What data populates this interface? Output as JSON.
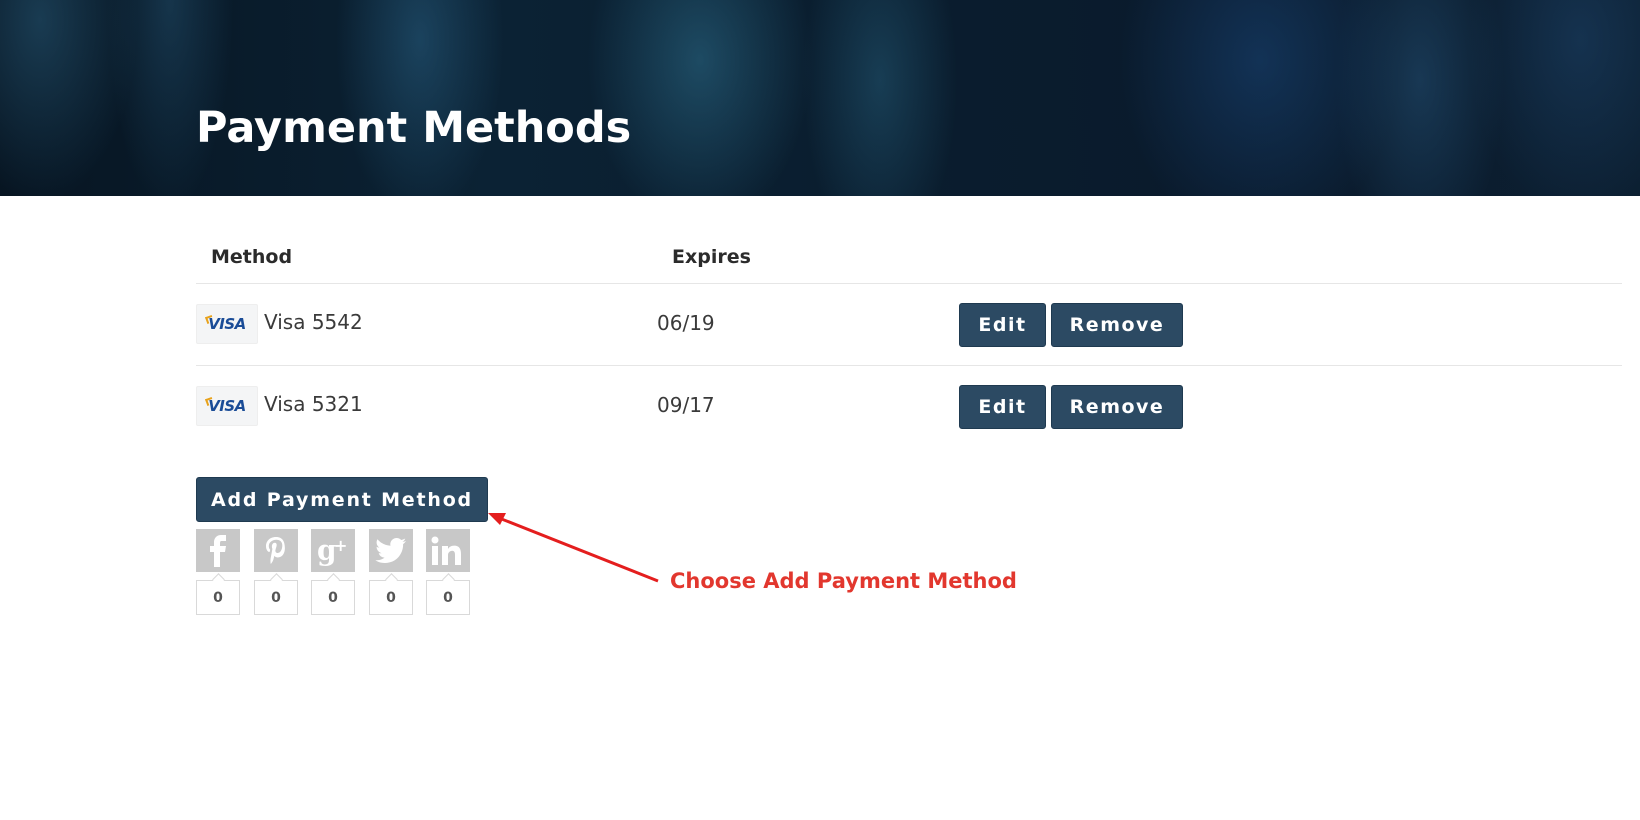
{
  "header": {
    "title": "Payment Methods"
  },
  "table": {
    "columns": {
      "method": "Method",
      "expires": "Expires"
    },
    "rows": [
      {
        "card_brand": "VISA",
        "method": "Visa 5542",
        "expires": "06/19",
        "edit_label": "Edit",
        "remove_label": "Remove"
      },
      {
        "card_brand": "VISA",
        "method": "Visa 5321",
        "expires": "09/17",
        "edit_label": "Edit",
        "remove_label": "Remove"
      }
    ]
  },
  "actions": {
    "add_label": "Add Payment Method"
  },
  "social": [
    {
      "icon": "facebook-icon",
      "glyph": "f",
      "count": "0"
    },
    {
      "icon": "pinterest-icon",
      "glyph": "p",
      "count": "0"
    },
    {
      "icon": "google-plus-icon",
      "glyph": "g+",
      "count": "0"
    },
    {
      "icon": "twitter-icon",
      "glyph": "🐦",
      "count": "0"
    },
    {
      "icon": "linkedin-icon",
      "glyph": "in",
      "count": "0"
    }
  ],
  "annotation": {
    "text": "Choose Add Payment Method",
    "color": "#e2372e"
  },
  "colors": {
    "button": "#2c4a63",
    "social_icon_bg": "#c8c8c8"
  }
}
